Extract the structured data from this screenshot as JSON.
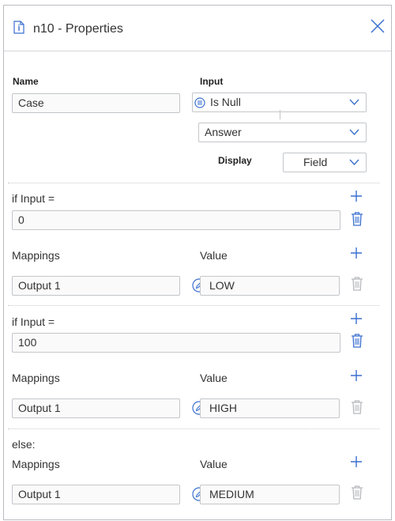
{
  "header": {
    "title": "n10 - Properties"
  },
  "name_section": {
    "name_label": "Name",
    "name_value": "Case",
    "input_label": "Input",
    "input_value": "Is Null",
    "answer_value": "Answer",
    "display_label": "Display",
    "display_value": "Field"
  },
  "cases": [
    {
      "if_label": "if Input =",
      "if_value": "0",
      "mappings_label": "Mappings",
      "value_label": "Value",
      "mapping_output": "Output 1",
      "mapping_value": "LOW"
    },
    {
      "if_label": "if Input =",
      "if_value": "100",
      "mappings_label": "Mappings",
      "value_label": "Value",
      "mapping_output": "Output 1",
      "mapping_value": "HIGH"
    }
  ],
  "else_case": {
    "else_label": "else:",
    "mappings_label": "Mappings",
    "value_label": "Value",
    "mapping_output": "Output 1",
    "mapping_value": "MEDIUM"
  },
  "colors": {
    "accent": "#3a6fd0",
    "disabled_icon": "#b7b9bd",
    "border": "#c3c6ca"
  }
}
